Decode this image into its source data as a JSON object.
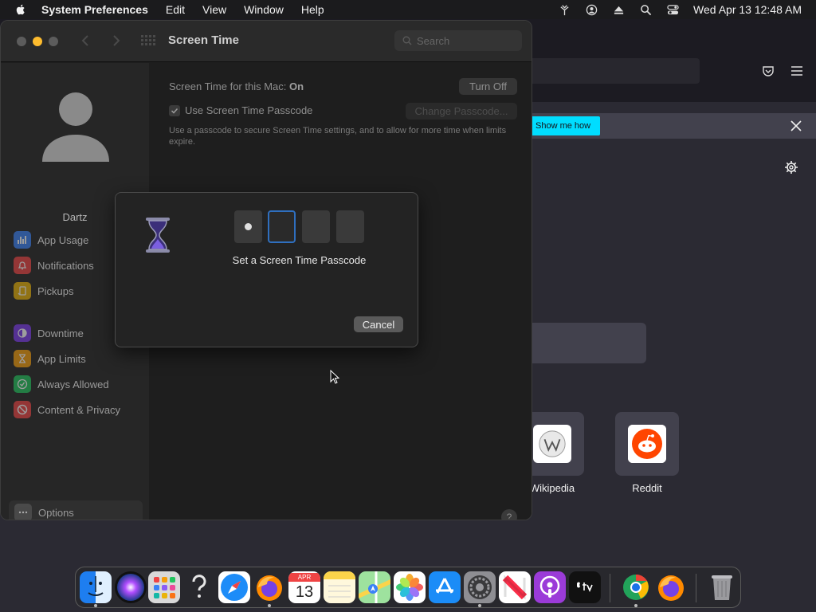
{
  "menubar": {
    "app_name": "System Preferences",
    "menus": [
      "Edit",
      "View",
      "Window",
      "Help"
    ],
    "clock": "Wed Apr 13  12:48 AM"
  },
  "browser": {
    "notification_button": "Show me how",
    "sites": [
      {
        "label": "Wikipedia"
      },
      {
        "label": "Reddit"
      }
    ]
  },
  "sys_prefs": {
    "title": "Screen Time",
    "search_placeholder": "Search",
    "username": "Dartz",
    "sidebar": {
      "items": [
        {
          "label": "App Usage",
          "color": "#3b82f6"
        },
        {
          "label": "Notifications",
          "color": "#ef4444"
        },
        {
          "label": "Pickups",
          "color": "#eab308"
        },
        {
          "label": "Downtime",
          "color": "#7c3aed"
        },
        {
          "label": "App Limits",
          "color": "#f59e0b"
        },
        {
          "label": "Always Allowed",
          "color": "#22c55e"
        },
        {
          "label": "Content & Privacy",
          "color": "#ef4444"
        }
      ],
      "options_label": "Options"
    },
    "content": {
      "status_label": "Screen Time for this Mac:",
      "status_value": "On",
      "turn_off_label": "Turn Off",
      "use_passcode_label": "Use Screen Time Passcode",
      "change_passcode_label": "Change Passcode...",
      "description": "Use a passcode to secure Screen Time settings, and to allow for more time when limits expire.",
      "help_label": "?"
    }
  },
  "passcode_sheet": {
    "prompt": "Set a Screen Time Passcode",
    "digits_entered": 1,
    "digits_total": 4,
    "cancel_label": "Cancel"
  },
  "dock": {
    "apps": [
      "Finder",
      "Siri",
      "Launchpad",
      "Help",
      "Safari",
      "Firefox",
      "Calendar",
      "Notes",
      "Maps",
      "Photos",
      "App Store",
      "System Preferences",
      "News",
      "Podcasts",
      "TV",
      "Chrome",
      "Firefox"
    ],
    "calendar": {
      "month": "APR",
      "day": "13"
    }
  }
}
